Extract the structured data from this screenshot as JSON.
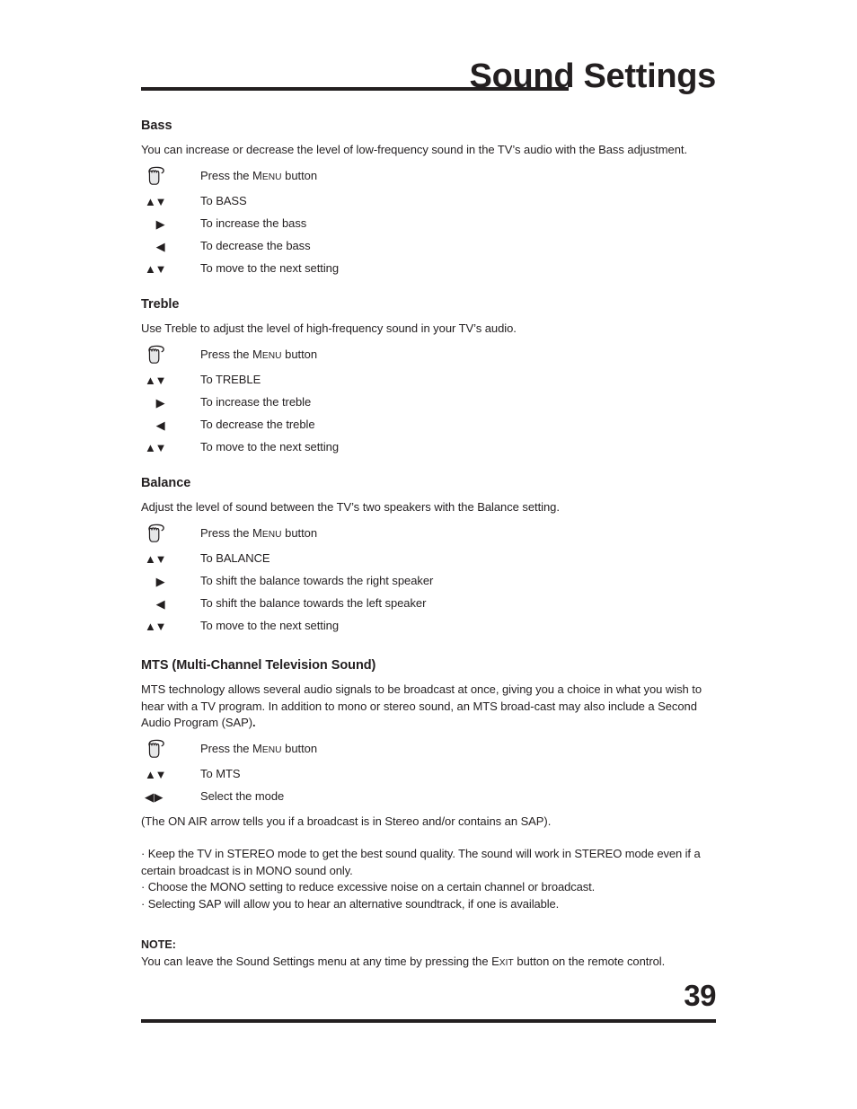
{
  "header": {
    "title": "Sound Settings"
  },
  "sections": [
    {
      "id": "bass",
      "heading": "Bass",
      "body": "You can increase or decrease the level of low-frequency sound in the TV’s audio with the Bass adjustment.",
      "steps": [
        {
          "icon": "hand-press-icon",
          "label_prefix": "Press the ",
          "label_smallcaps_first": "M",
          "label_smallcaps_rest": "ENU",
          "label_suffix": " button"
        },
        {
          "icon": "up-down-arrows-icon",
          "glyphs": "▲▼",
          "label": "To BASS"
        },
        {
          "icon": "right-arrow-icon",
          "glyphs": "▶",
          "label": "To increase the bass"
        },
        {
          "icon": "left-arrow-icon",
          "glyphs": "◀",
          "label": "To decrease the bass"
        },
        {
          "icon": "up-down-arrows-icon",
          "glyphs": "▲▼",
          "label": "To move to the next setting"
        }
      ]
    },
    {
      "id": "treble",
      "heading": "Treble",
      "body": "Use Treble to adjust the level of high-frequency sound in your TV’s audio.",
      "steps": [
        {
          "icon": "hand-press-icon",
          "label_prefix": "Press the ",
          "label_smallcaps_first": "M",
          "label_smallcaps_rest": "ENU",
          "label_suffix": " button"
        },
        {
          "icon": "up-down-arrows-icon",
          "glyphs": "▲▼",
          "label": "To TREBLE"
        },
        {
          "icon": "right-arrow-icon",
          "glyphs": "▶",
          "label": "To increase the treble"
        },
        {
          "icon": "left-arrow-icon",
          "glyphs": "◀",
          "label": "To decrease the treble"
        },
        {
          "icon": "up-down-arrows-icon",
          "glyphs": "▲▼",
          "label": "To move to the next setting"
        }
      ]
    },
    {
      "id": "balance",
      "heading": "Balance",
      "body": "Adjust the level of sound between the TV’s two speakers with the Balance setting.",
      "steps": [
        {
          "icon": "hand-press-icon",
          "label_prefix": "Press the ",
          "label_smallcaps_first": "M",
          "label_smallcaps_rest": "ENU",
          "label_suffix": " button"
        },
        {
          "icon": "up-down-arrows-icon",
          "glyphs": "▲▼",
          "label": "To BALANCE"
        },
        {
          "icon": "right-arrow-icon",
          "glyphs": "▶",
          "label": "To shift the balance towards the right speaker"
        },
        {
          "icon": "left-arrow-icon",
          "glyphs": "◀",
          "label": "To shift the balance towards the left speaker"
        },
        {
          "icon": "up-down-arrows-icon",
          "glyphs": "▲▼",
          "label": "To move to the next setting"
        }
      ]
    },
    {
      "id": "mts",
      "heading": "MTS (Multi-Channel Television Sound)",
      "body": "MTS technology allows several audio signals to be broadcast at once, giving you a choice in what you wish to hear with a TV program. In addition to mono or stereo sound, an MTS broad-cast may also include a Second Audio Program (SAP)",
      "body_bold_end": ".",
      "steps": [
        {
          "icon": "hand-press-icon",
          "label_prefix": "Press the ",
          "label_smallcaps_first": "M",
          "label_smallcaps_rest": "ENU",
          "label_suffix": " button"
        },
        {
          "icon": "up-down-arrows-icon",
          "glyphs": "▲▼",
          "label": "To MTS"
        },
        {
          "icon": "left-right-arrows-icon",
          "glyphs": "◀▶",
          "label": "Select the mode"
        }
      ],
      "paren_note": "(The ON AIR arrow tells you if a broadcast is in Stereo and/or contains an SAP)."
    }
  ],
  "bullets": [
    "·  Keep the TV in STEREO mode to get the best sound quality. The sound will work in STEREO mode even if a certain broadcast is in MONO sound only.",
    "· Choose the MONO setting to reduce excessive noise on a certain channel or broadcast.",
    "· Selecting SAP will allow you to hear an alternative soundtrack, if one is available."
  ],
  "note": {
    "title": "NOTE:",
    "text_prefix": "You can leave the Sound Settings menu at any time by pressing the ",
    "smallcaps_first": "E",
    "smallcaps_rest": "XIT",
    "text_suffix": " button on the remote control."
  },
  "footer": {
    "page_number": "39"
  },
  "colors": {
    "ink": "#231f20",
    "icon_fill": "#e6e7e8",
    "background": "#ffffff"
  }
}
